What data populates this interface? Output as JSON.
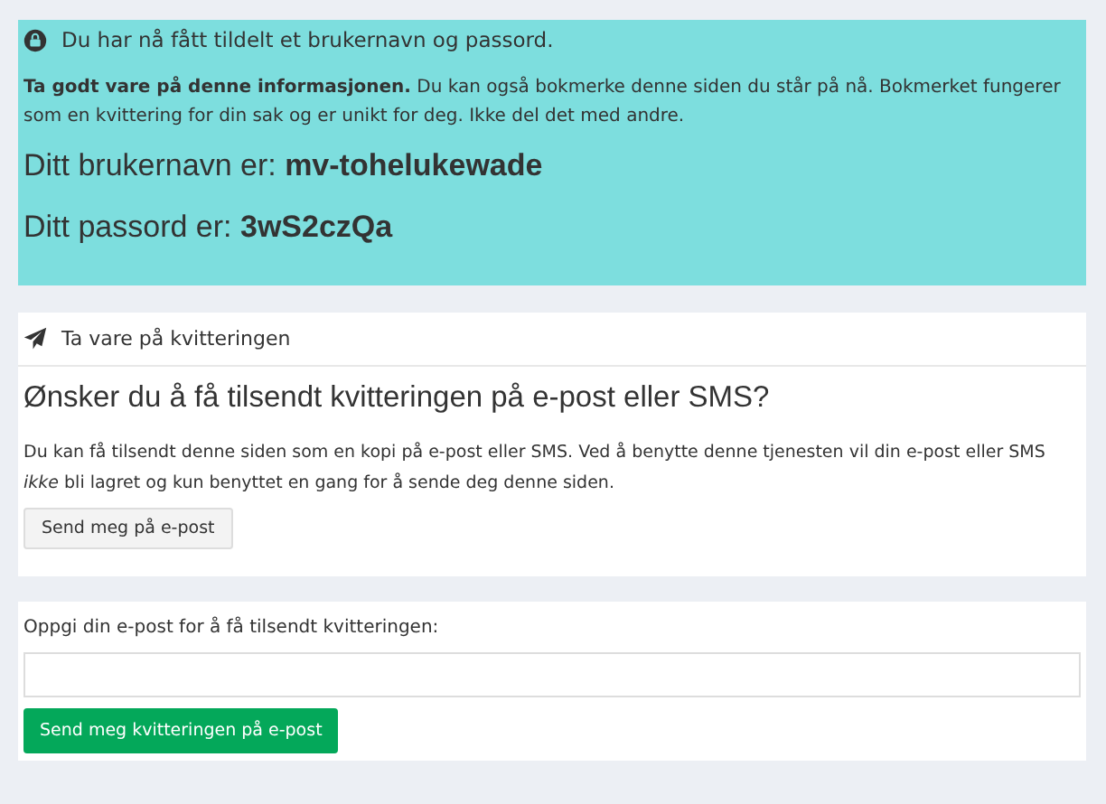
{
  "alert": {
    "title": "Du har nå fått tildelt et brukernavn og passord.",
    "message": "**Ta godt vare på denne informasjonen.** Du kan også bokmerke denne siden du står på nå. Bokmerket fungerer som en kvittering for din sak og er unikt for deg. Ikke del det med andre.",
    "credentials": [
      "Ditt brukernavn er: **mv-tohelukewade**",
      "Ditt passord er: **3wS2czQa**"
    ]
  },
  "receipt_card": {
    "header": "Ta vare på kvitteringen",
    "heading": "Ønsker du å få tilsendt kvitteringen på e-post eller SMS?",
    "text": "Du kan få tilsendt denne siden som en kopi på e-post eller SMS. Ved å benytte denne tjenesten vil din e-post eller SMS *ikke* bli lagret og kun benyttet en gang for å sende deg denne siden.",
    "button": "Send meg på e-post"
  },
  "email_form": {
    "label": "Oppgi din e-post for å få tilsendt kvitteringen:",
    "submit": "Send meg kvitteringen på e-post"
  }
}
